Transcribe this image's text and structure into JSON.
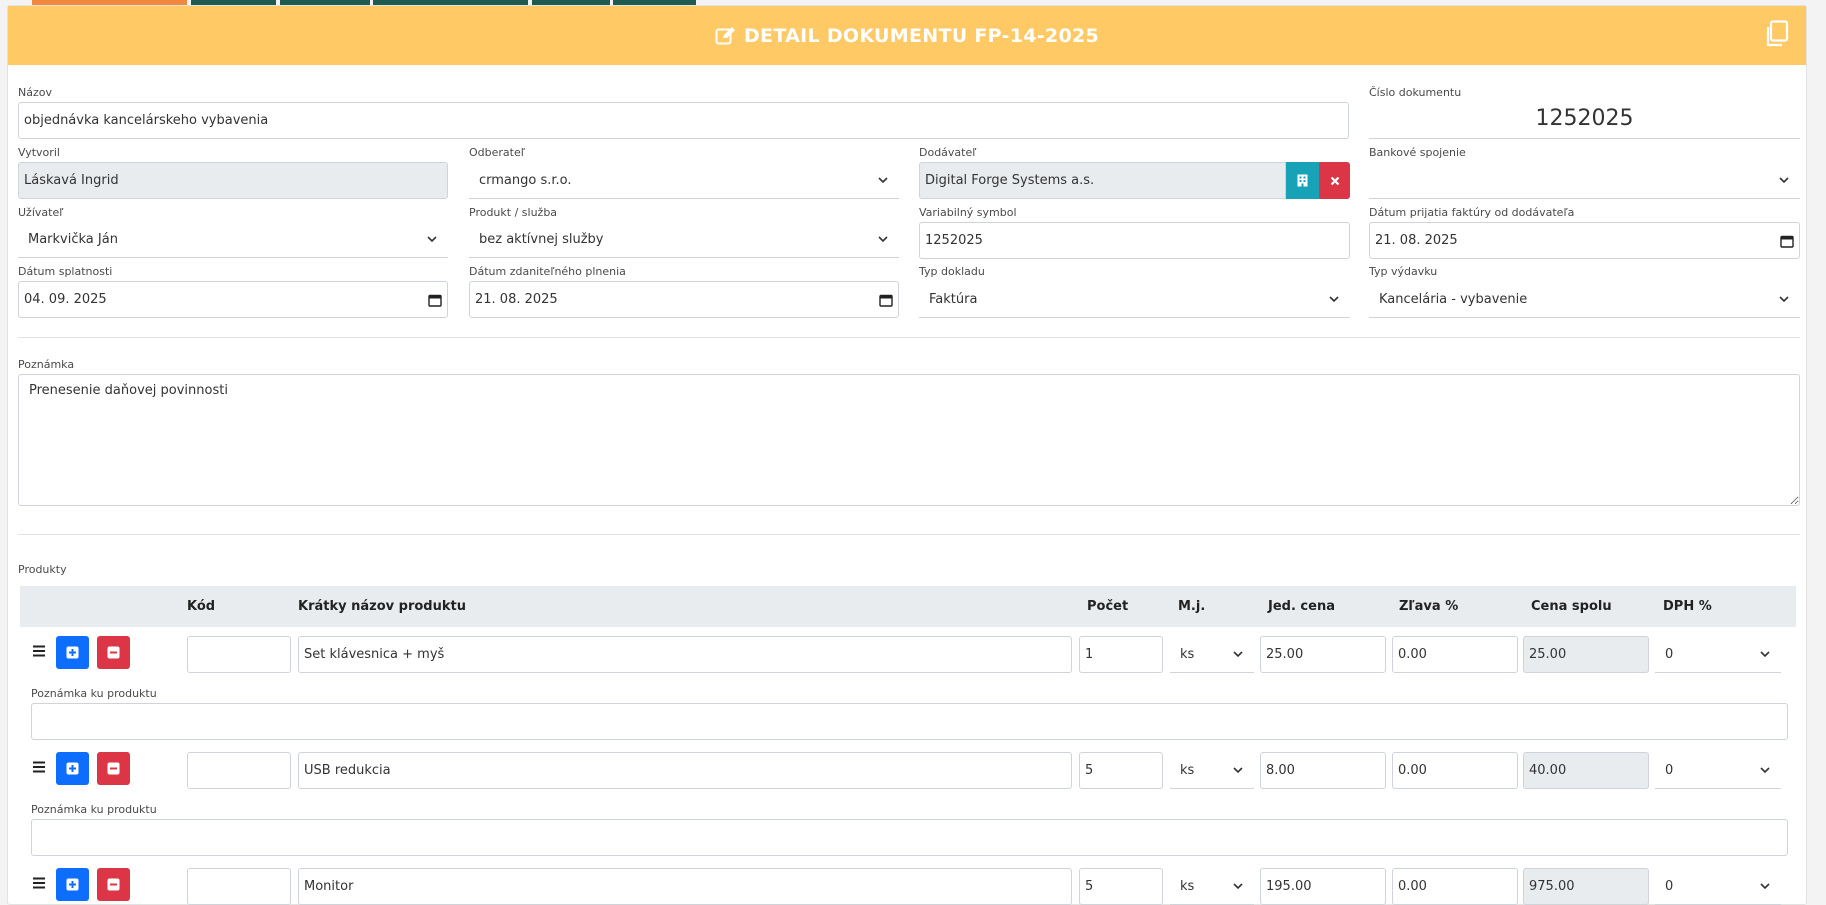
{
  "header": {
    "title": "DETAIL DOKUMENTU FP-14-2025",
    "edit_icon": "edit-icon",
    "copy_icon": "copy-icon"
  },
  "form": {
    "nazov": {
      "label": "Názov",
      "value": "objednávka kancelárskeho vybavenia"
    },
    "cislo": {
      "label": "Číslo dokumentu",
      "value": "1252025"
    },
    "vytvoril": {
      "label": "Vytvoril",
      "value": "Láskavá Ingrid"
    },
    "odberatel": {
      "label": "Odberateľ",
      "value": "crmango s.r.o."
    },
    "dodavatel": {
      "label": "Dodávateľ",
      "value": "Digital Forge Systems a.s."
    },
    "bankove": {
      "label": "Bankové spojenie",
      "value": ""
    },
    "uzivatel": {
      "label": "Užívateľ",
      "value": "Markvička Ján"
    },
    "produkt": {
      "label": "Produkt / služba",
      "value": "bez aktívnej služby"
    },
    "vs": {
      "label": "Variabilný symbol",
      "value": "1252025"
    },
    "datum_prijatia": {
      "label": "Dátum prijatia faktúry od dodávateľa",
      "value": "21. 08. 2025"
    },
    "datum_splatnosti": {
      "label": "Dátum splatnosti",
      "value": "04. 09. 2025"
    },
    "datum_zdanitelneho": {
      "label": "Dátum zdaniteľného plnenia",
      "value": "21. 08. 2025"
    },
    "typ_dokladu": {
      "label": "Typ dokladu",
      "value": "Faktúra"
    },
    "typ_vydavku": {
      "label": "Typ výdavku",
      "value": "Kancelária - vybavenie"
    },
    "poznamka": {
      "label": "Poznámka",
      "value": "Prenesenie daňovej povinnosti"
    }
  },
  "products": {
    "section_label": "Produkty",
    "columns": {
      "kod": "Kód",
      "nazov": "Krátky názov produktu",
      "pocet": "Počet",
      "mj": "M.j.",
      "jed_cena": "Jed. cena",
      "zlava": "Zľava %",
      "cena_spolu": "Cena spolu",
      "dph": "DPH %"
    },
    "note_label": "Poznámka ku produktu",
    "rows": [
      {
        "kod": "",
        "nazov": "Set klávesnica + myš",
        "pocet": "1",
        "mj": "ks",
        "jed_cena": "25.00",
        "zlava": "0.00",
        "cena_spolu": "25.00",
        "dph": "0",
        "note": ""
      },
      {
        "kod": "",
        "nazov": "USB redukcia",
        "pocet": "5",
        "mj": "ks",
        "jed_cena": "8.00",
        "zlava": "0.00",
        "cena_spolu": "40.00",
        "dph": "0",
        "note": ""
      },
      {
        "kod": "",
        "nazov": "Monitor",
        "pocet": "5",
        "mj": "ks",
        "jed_cena": "195.00",
        "zlava": "0.00",
        "cena_spolu": "975.00",
        "dph": "0",
        "note": ""
      }
    ]
  },
  "colors": {
    "header_bg": "#ffc966",
    "tab_active": "#f0883e",
    "tab_inactive": "#1f5b4e",
    "add_button": "#0d6efd",
    "remove_button": "#dc3545",
    "building_button": "#17a2b8"
  }
}
